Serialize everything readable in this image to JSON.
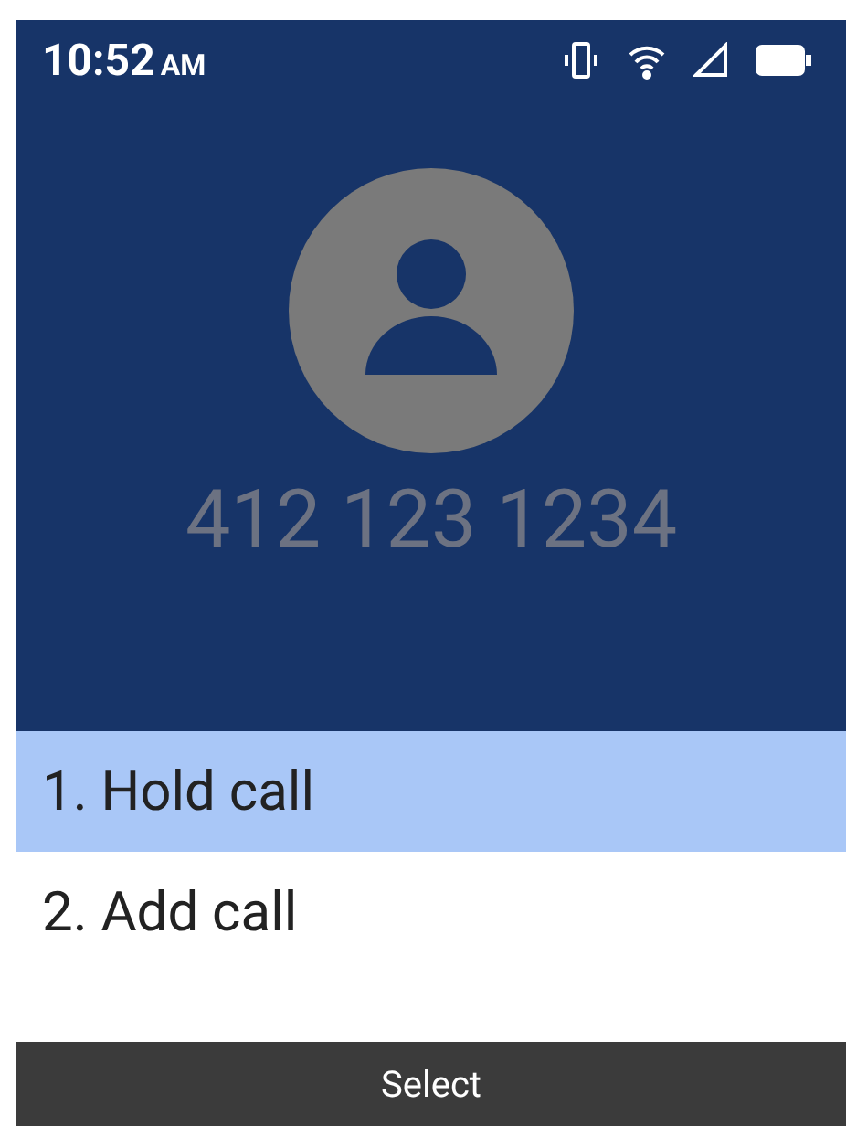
{
  "status_bar": {
    "time": "10:52",
    "meridiem": "AM"
  },
  "call": {
    "number": "412 123 1234"
  },
  "menu": [
    {
      "label": "1. Hold call",
      "selected": true
    },
    {
      "label": "2. Add call",
      "selected": false
    }
  ],
  "softkey": {
    "center": "Select"
  }
}
